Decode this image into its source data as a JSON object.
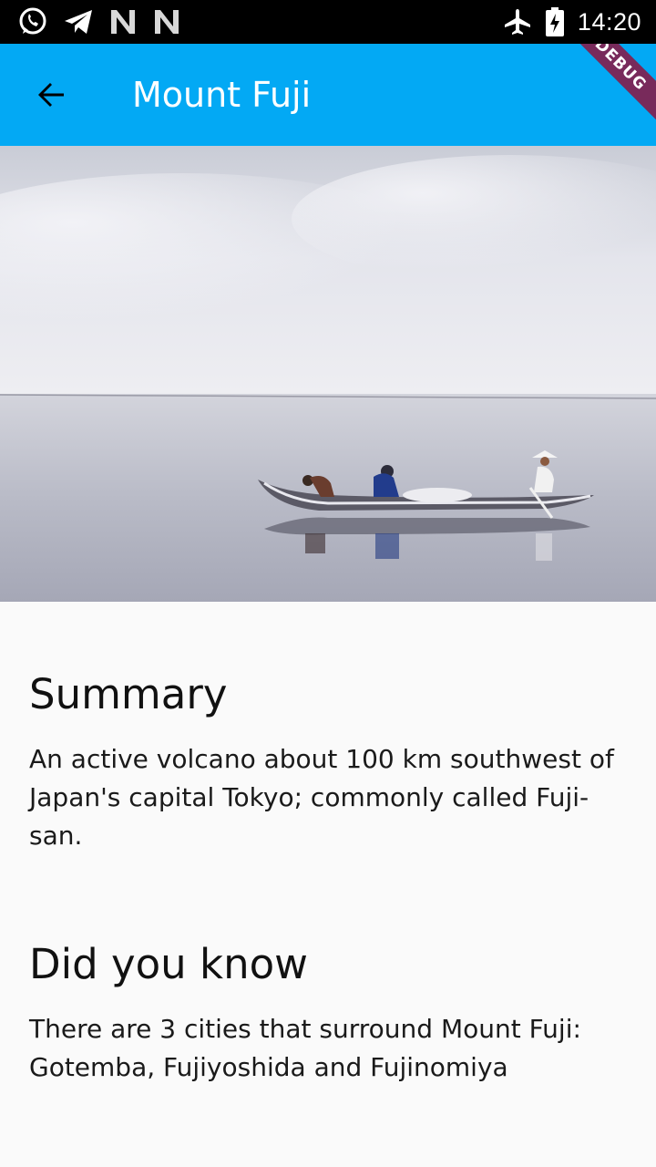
{
  "status_bar": {
    "time": "14:20",
    "left_icons": [
      "whatsapp-icon",
      "telegram-icon",
      "n-icon",
      "n-icon"
    ],
    "right_icons": [
      "airplane-mode-icon",
      "battery-charging-icon"
    ]
  },
  "app_bar": {
    "title": "Mount Fuji",
    "back_icon": "arrow-back-icon",
    "background_color": "#03a9f4",
    "debug_banner": "DEBUG"
  },
  "hero_image": {
    "subject": "fishermen in a wooden boat on calm water"
  },
  "sections": [
    {
      "heading": "Summary",
      "body": "An active volcano about 100 km southwest of Japan's capital Tokyo; commonly called Fuji-san."
    },
    {
      "heading": "Did you know",
      "body": "There are 3 cities that surround Mount Fuji: Gotemba, Fujiyoshida and Fujinomiya"
    }
  ]
}
